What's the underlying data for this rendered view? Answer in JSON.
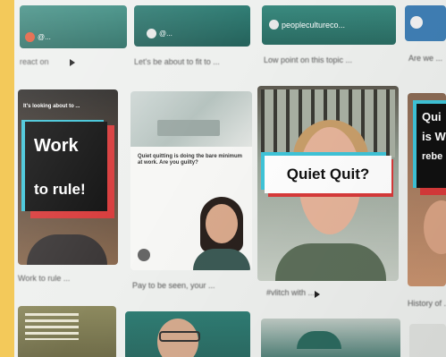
{
  "top_row": [
    {
      "handle": "@...",
      "caption": "react on",
      "play_icon": "play-icon"
    },
    {
      "handle": "@...",
      "caption": "Let's be about to fit to ..."
    },
    {
      "handle": "peoplecultureco...",
      "caption": "Low point on this topic ..."
    },
    {
      "handle": "",
      "caption": "Are we ..."
    }
  ],
  "mid_row": [
    {
      "overlay_top": "It's looking about to ...",
      "overlay_line1": "Work",
      "overlay_line2": "to rule!",
      "caption": "Work to rule ..."
    },
    {
      "article_text": "Quiet quitting is doing the bare minimum at work. Are you guilty?",
      "caption": "Pay to be seen, your ..."
    },
    {
      "overlay": "Quiet Quit?",
      "caption": "#vlitch with ...",
      "play_icon": "play-icon"
    },
    {
      "overlay_line1": "Qui",
      "overlay_line2": "is W",
      "overlay_line3": "rebe",
      "caption": "History of ..."
    }
  ],
  "colors": {
    "frame": "#f3c95a",
    "teal": "#2f7d74",
    "red": "#d83a3a",
    "cyan": "#3fc4d8"
  }
}
